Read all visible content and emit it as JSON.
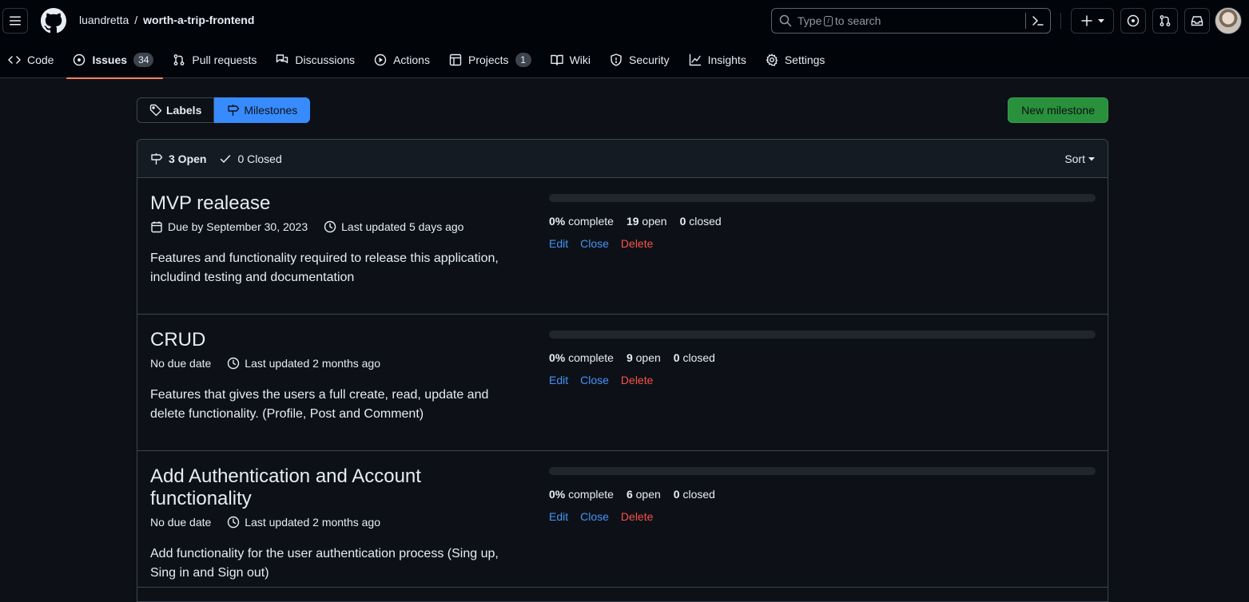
{
  "header": {
    "owner": "luandretta",
    "separator": "/",
    "repo": "worth-a-trip-frontend",
    "search": {
      "prefix": "Type",
      "key": "/",
      "suffix": "to search"
    }
  },
  "nav": [
    {
      "label": "Code",
      "icon": "code-icon"
    },
    {
      "label": "Issues",
      "icon": "issue-opened-icon",
      "count": "34",
      "selected": true
    },
    {
      "label": "Pull requests",
      "icon": "git-pull-request-icon"
    },
    {
      "label": "Discussions",
      "icon": "comment-discussion-icon"
    },
    {
      "label": "Actions",
      "icon": "play-icon"
    },
    {
      "label": "Projects",
      "icon": "table-icon",
      "count": "1"
    },
    {
      "label": "Wiki",
      "icon": "book-icon"
    },
    {
      "label": "Security",
      "icon": "shield-icon"
    },
    {
      "label": "Insights",
      "icon": "graph-icon"
    },
    {
      "label": "Settings",
      "icon": "gear-icon"
    }
  ],
  "subnav": {
    "labels": "Labels",
    "milestones": "Milestones",
    "new_milestone": "New milestone"
  },
  "filter": {
    "open": "3 Open",
    "closed": "0 Closed",
    "sort": "Sort"
  },
  "milestones": [
    {
      "title": "MVP realease",
      "due": "Due by September 30, 2023",
      "updated": "Last updated 5 days ago",
      "description": "Features and functionality required to release this application, includind testing and documentation",
      "percent": "0%",
      "complete_label": "complete",
      "open": "19",
      "open_label": "open",
      "closed": "0",
      "closed_label": "closed",
      "progress": 0,
      "edit": "Edit",
      "close": "Close",
      "delete": "Delete"
    },
    {
      "title": "CRUD",
      "due": "No due date",
      "updated": "Last updated 2 months ago",
      "description": "Features that gives the users a full create, read, update and delete functionality. (Profile, Post and Comment)",
      "percent": "0%",
      "complete_label": "complete",
      "open": "9",
      "open_label": "open",
      "closed": "0",
      "closed_label": "closed",
      "progress": 0,
      "edit": "Edit",
      "close": "Close",
      "delete": "Delete"
    },
    {
      "title": "Add Authentication and Account functionality",
      "due": "No due date",
      "updated": "Last updated 2 months ago",
      "description": "Add functionality for the user authentication process (Sing up, Sing in and Sign out)",
      "percent": "0%",
      "complete_label": "complete",
      "open": "6",
      "open_label": "open",
      "closed": "0",
      "closed_label": "closed",
      "progress": 0,
      "edit": "Edit",
      "close": "Close",
      "delete": "Delete"
    }
  ]
}
